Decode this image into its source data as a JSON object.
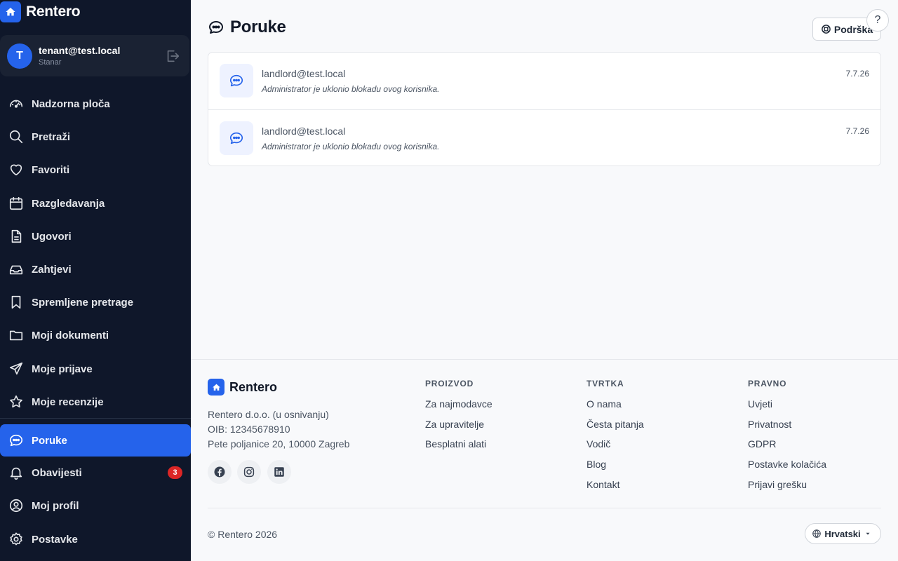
{
  "brand": {
    "name": "Rentero",
    "accent": "#2563eb"
  },
  "user": {
    "initial": "T",
    "email": "tenant@test.local",
    "role": "Stanar"
  },
  "sidebar": {
    "items": [
      {
        "label": "Nadzorna ploča",
        "icon": "dashboard-gauge-icon"
      },
      {
        "label": "Pretraži",
        "icon": "search-icon"
      },
      {
        "label": "Favoriti",
        "icon": "heart-icon"
      },
      {
        "label": "Razgledavanja",
        "icon": "calendar-icon"
      },
      {
        "label": "Ugovori",
        "icon": "document-icon"
      },
      {
        "label": "Zahtjevi",
        "icon": "inbox-icon"
      },
      {
        "label": "Spremljene pretrage",
        "icon": "bookmark-icon"
      },
      {
        "label": "Moji dokumenti",
        "icon": "folder-icon"
      },
      {
        "label": "Moje prijave",
        "icon": "send-icon"
      },
      {
        "label": "Moje recenzije",
        "icon": "star-icon"
      },
      {
        "label": "Poruke",
        "icon": "chat-icon",
        "active": true
      },
      {
        "label": "Obavijesti",
        "icon": "bell-icon",
        "badge": "3"
      },
      {
        "label": "Moj profil",
        "icon": "user-circle-icon"
      },
      {
        "label": "Postavke",
        "icon": "gear-icon"
      }
    ]
  },
  "header": {
    "title": "Poruke",
    "support_label": "Podrška",
    "help_label": "?"
  },
  "messages": [
    {
      "from": "landlord@test.local",
      "preview": "Administrator je uklonio blokadu ovog korisnika.",
      "date": "7.7.26"
    },
    {
      "from": "landlord@test.local",
      "preview": "Administrator je uklonio blokadu ovog korisnika.",
      "date": "7.7.26"
    }
  ],
  "footer": {
    "brand": "Rentero",
    "company": "Rentero d.o.o. (u osnivanju)",
    "oib": "OIB: 12345678910",
    "address": "Pete poljanice 20, 10000 Zagreb",
    "social": [
      "facebook-icon",
      "instagram-icon",
      "linkedin-icon"
    ],
    "columns": [
      {
        "title": "PROIZVOD",
        "links": [
          "Za najmodavce",
          "Za upravitelje",
          "Besplatni alati"
        ]
      },
      {
        "title": "TVRTKA",
        "links": [
          "O nama",
          "Česta pitanja",
          "Vodič",
          "Blog",
          "Kontakt"
        ]
      },
      {
        "title": "PRAVNO",
        "links": [
          "Uvjeti",
          "Privatnost",
          "GDPR",
          "Postavke kolačića",
          "Prijavi grešku"
        ]
      }
    ],
    "copyright": "© Rentero 2026",
    "language": "Hrvatski"
  }
}
